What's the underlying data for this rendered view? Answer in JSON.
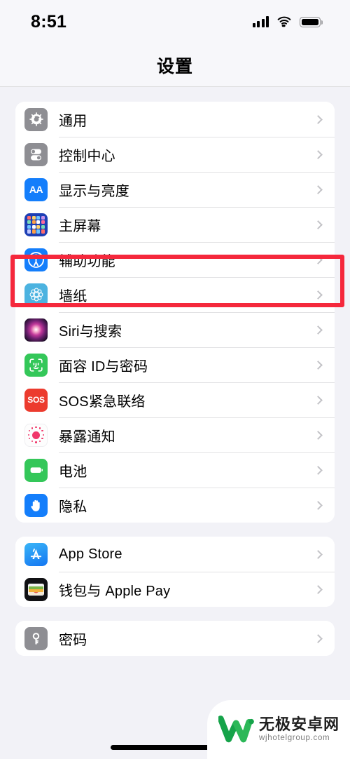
{
  "status_bar": {
    "time": "8:51",
    "signal_icon": "cellular-signal-icon",
    "wifi_icon": "wifi-icon",
    "battery_icon": "battery-full-icon"
  },
  "nav": {
    "title": "设置"
  },
  "highlight": {
    "color": "#f5283c",
    "target_row": "辅助功能"
  },
  "groups": [
    {
      "id": "system-group",
      "rows": [
        {
          "label": "通用",
          "icon": "gear-icon"
        },
        {
          "label": "控制中心",
          "icon": "control-center-icon"
        },
        {
          "label": "显示与亮度",
          "icon": "display-brightness-icon"
        },
        {
          "label": "主屏幕",
          "icon": "home-screen-icon"
        },
        {
          "label": "辅助功能",
          "icon": "accessibility-icon"
        },
        {
          "label": "墙纸",
          "icon": "wallpaper-icon"
        },
        {
          "label": "Siri与搜索",
          "icon": "siri-icon"
        },
        {
          "label": "面容 ID与密码",
          "icon": "face-id-icon"
        },
        {
          "label": "SOS紧急联络",
          "icon": "sos-icon"
        },
        {
          "label": "暴露通知",
          "icon": "exposure-notification-icon"
        },
        {
          "label": "电池",
          "icon": "battery-icon"
        },
        {
          "label": "隐私",
          "icon": "privacy-hand-icon"
        }
      ]
    },
    {
      "id": "store-group",
      "rows": [
        {
          "label": "App Store",
          "icon": "app-store-icon"
        },
        {
          "label": "钱包与 Apple Pay",
          "icon": "wallet-icon"
        }
      ]
    },
    {
      "id": "passwords-group",
      "rows": [
        {
          "label": "密码",
          "icon": "key-icon"
        }
      ]
    }
  ],
  "watermark": {
    "site_name": "无极安卓网",
    "url": "wjhotelgroup.com",
    "logo_color": "#16a34a"
  }
}
